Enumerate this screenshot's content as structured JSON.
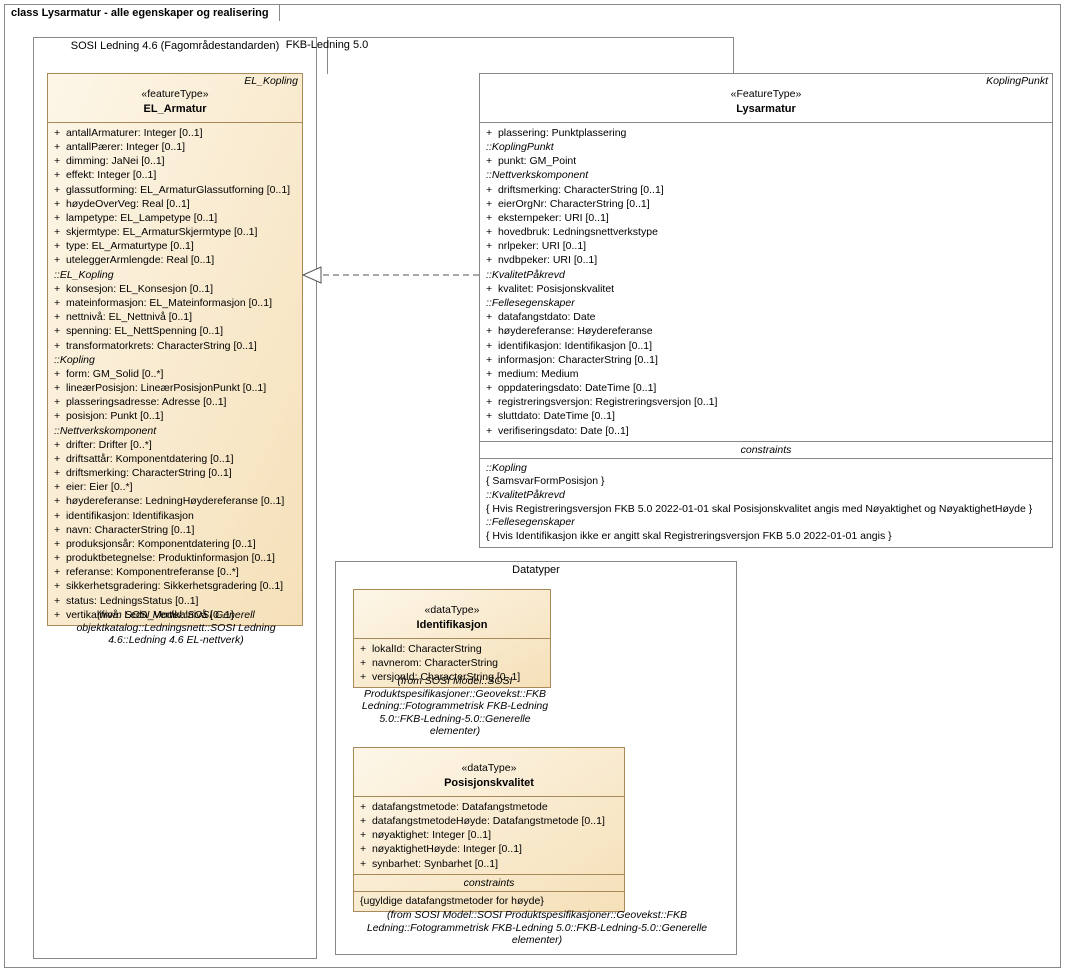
{
  "diagram_title": "class Lysarmatur - alle egenskaper og realisering",
  "packages": {
    "sosi46": {
      "label": "SOSI Ledning 4.6 (Fagområdestandarden)"
    },
    "fkb50": {
      "label": "FKB-Ledning 5.0"
    },
    "datatyper": {
      "label": "Datatyper"
    }
  },
  "el_armatur": {
    "corner": "EL_Kopling",
    "stereo": "«featureType»",
    "name": "EL_Armatur",
    "attrs_main": [
      "antallArmaturer: Integer [0..1]",
      "antallPærer: Integer [0..1]",
      "dimming: JaNei [0..1]",
      "effekt: Integer [0..1]",
      "glassutforming: EL_ArmaturGlassutforning [0..1]",
      "høydeOverVeg: Real [0..1]",
      "lampetype: EL_Lampetype [0..1]",
      "skjermtype: EL_ArmaturSkjermtype [0..1]",
      "type: EL_Armaturtype [0..1]",
      "uteleggerArmlengde: Real [0..1]"
    ],
    "sec_el_kopling": "::EL_Kopling",
    "attrs_el_kopling": [
      "konsesjon: EL_Konsesjon [0..1]",
      "mateinformasjon: EL_Mateinformasjon [0..1]",
      "nettnivå: EL_Nettnivå [0..1]",
      "spenning: EL_NettSpenning [0..1]",
      "transformatorkrets: CharacterString [0..1]"
    ],
    "sec_kopling": "::Kopling",
    "attrs_kopling": [
      "form: GM_Solid [0..*]",
      "lineærPosisjon: LineærPosisjonPunkt [0..1]",
      "plasseringsadresse: Adresse [0..1]",
      "posisjon: Punkt [0..1]"
    ],
    "sec_nettverk": "::Nettverkskomponent",
    "attrs_nettverk": [
      "drifter: Drifter [0..*]",
      "driftsattår: Komponentdatering [0..1]",
      "driftsmerking: CharacterString [0..1]",
      "eier: Eier [0..*]",
      "høydereferanse: LedningHøydereferanse [0..1]",
      "identifikasjon: Identifikasjon",
      "navn: CharacterString [0..1]",
      "produksjonsår: Komponentdatering [0..1]",
      "produktbetegnelse: Produktinformasjon [0..1]",
      "referanse: Komponentreferanse [0..*]",
      "sikkerhetsgradering: Sikkerhetsgradering [0..1]",
      "status: LedningsStatus [0..1]",
      "vertikalnivå: Ledn_Vertikalnivå [0..1]"
    ],
    "from": "(from SOSI Model::SOSI Generell objektkatalog::Ledningsnett::SOSI Ledning 4.6::Ledning 4.6 EL-nettverk)"
  },
  "lysarmatur": {
    "corner": "KoplingPunkt",
    "stereo": "«FeatureType»",
    "name": "Lysarmatur",
    "attrs_main": [
      "plassering: Punktplassering"
    ],
    "sec_koplingpunkt": "::KoplingPunkt",
    "attrs_koplingpunkt": [
      "punkt: GM_Point"
    ],
    "sec_nettverk": "::Nettverkskomponent",
    "attrs_nettverk": [
      "driftsmerking: CharacterString [0..1]",
      "eierOrgNr: CharacterString [0..1]",
      "eksternpeker: URI [0..1]",
      "hovedbruk: Ledningsnettverkstype",
      "nrlpeker: URI [0..1]",
      "nvdbpeker: URI [0..1]"
    ],
    "sec_kvalitet": "::KvalitetPåkrevd",
    "attrs_kvalitet": [
      "kvalitet: Posisjonskvalitet"
    ],
    "sec_felles": "::Fellesegenskaper",
    "attrs_felles": [
      "datafangstdato: Date",
      "høydereferanse: Høydereferanse",
      "identifikasjon: Identifikasjon [0..1]",
      "informasjon: CharacterString [0..1]",
      "medium: Medium",
      "oppdateringsdato: DateTime [0..1]",
      "registreringsversjon: Registreringsversjon [0..1]",
      "sluttdato: DateTime [0..1]",
      "verifiseringsdato: Date [0..1]"
    ],
    "constraints_label": "constraints",
    "c_kopling_hdr": "::Kopling",
    "c_kopling": "{ SamsvarFormPosisjon }",
    "c_kvalitet_hdr": "::KvalitetPåkrevd",
    "c_kvalitet": "{ Hvis Registreringsversjon FKB 5.0 2022-01-01 skal Posisjonskvalitet angis med Nøyaktighet og NøyaktighetHøyde }",
    "c_felles_hdr": "::Fellesegenskaper",
    "c_felles": "{ Hvis Identifikasjon ikke er angitt skal Registreringsversjon FKB 5.0 2022-01-01 angis }"
  },
  "identifikasjon": {
    "stereo": "«dataType»",
    "name": "Identifikasjon",
    "attrs": [
      "lokalId: CharacterString",
      "navnerom: CharacterString",
      "versjonId: CharacterString [0..1]"
    ],
    "from": "(from SOSI Model::SOSI Produktspesifikasjoner::Geovekst::FKB Ledning::Fotogrammetrisk FKB-Ledning 5.0::FKB-Ledning-5.0::Generelle elementer)"
  },
  "posisjonskvalitet": {
    "stereo": "«dataType»",
    "name": "Posisjonskvalitet",
    "attrs": [
      "datafangstmetode: Datafangstmetode",
      "datafangstmetodeHøyde: Datafangstmetode [0..1]",
      "nøyaktighet: Integer [0..1]",
      "nøyaktighetHøyde: Integer [0..1]",
      "synbarhet: Synbarhet [0..1]"
    ],
    "constraints_label": "constraints",
    "c1": "{ugyldige datafangstmetoder for høyde}",
    "from": "(from SOSI Model::SOSI Produktspesifikasjoner::Geovekst::FKB Ledning::Fotogrammetrisk FKB-Ledning 5.0::FKB-Ledning-5.0::Generelle elementer)"
  }
}
